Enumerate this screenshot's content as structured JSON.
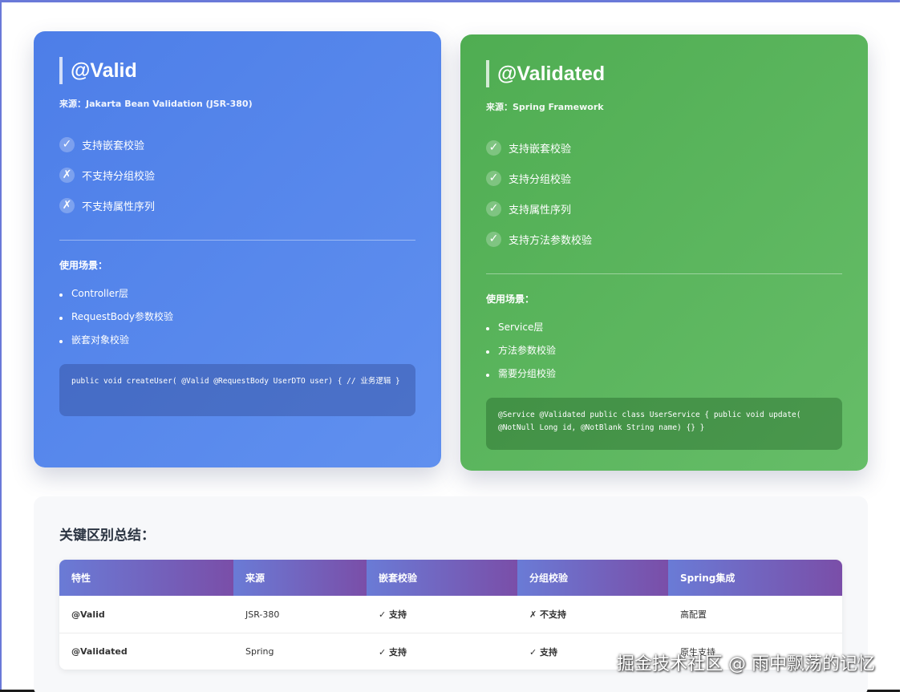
{
  "valid_card": {
    "title": "@Valid",
    "source": "来源：Jakarta Bean Validation (JSR-380)",
    "features": [
      {
        "icon": "✓",
        "icon_name": "check-icon",
        "label": "支持嵌套校验"
      },
      {
        "icon": "✗",
        "icon_name": "cross-icon",
        "label": "不支持分组校验"
      },
      {
        "icon": "✗",
        "icon_name": "cross-icon",
        "label": "不支持属性序列"
      }
    ],
    "scenario_title": "使用场景：",
    "scenarios": [
      "Controller层",
      "RequestBody参数校验",
      "嵌套对象校验"
    ],
    "code": "public void createUser( @Valid @RequestBody UserDTO user) { // 业务逻辑 }"
  },
  "validated_card": {
    "title": "@Validated",
    "source": "来源：Spring Framework",
    "features": [
      {
        "icon": "✓",
        "icon_name": "check-icon",
        "label": "支持嵌套校验"
      },
      {
        "icon": "✓",
        "icon_name": "check-icon",
        "label": "支持分组校验"
      },
      {
        "icon": "✓",
        "icon_name": "check-icon",
        "label": "支持属性序列"
      },
      {
        "icon": "✓",
        "icon_name": "check-icon",
        "label": "支持方法参数校验"
      }
    ],
    "scenario_title": "使用场景：",
    "scenarios": [
      "Service层",
      "方法参数校验",
      "需要分组校验"
    ],
    "code": "@Service @Validated public class UserService { public void update( @NotNull Long id, @NotBlank String name) {} }"
  },
  "summary": {
    "title": "关键区别总结：",
    "headers": [
      "特性",
      "来源",
      "嵌套校验",
      "分组校验",
      "Spring集成"
    ],
    "rows": [
      [
        "@Valid",
        "JSR-380",
        "✓ 支持",
        "✗ 不支持",
        "高配置"
      ],
      [
        "@Validated",
        "Spring",
        "✓ 支持",
        "✓ 支持",
        "原生支持"
      ]
    ]
  },
  "watermark": "掘金技术社区 @ 雨中飘荡的记忆",
  "colors": {
    "valid_card": "#4d7ee8",
    "validated_card": "#4fad52",
    "table_header_start": "#6a7bd6",
    "table_header_end": "#7a4ea8",
    "yes": "#3b9b43",
    "no": "#d64536"
  }
}
